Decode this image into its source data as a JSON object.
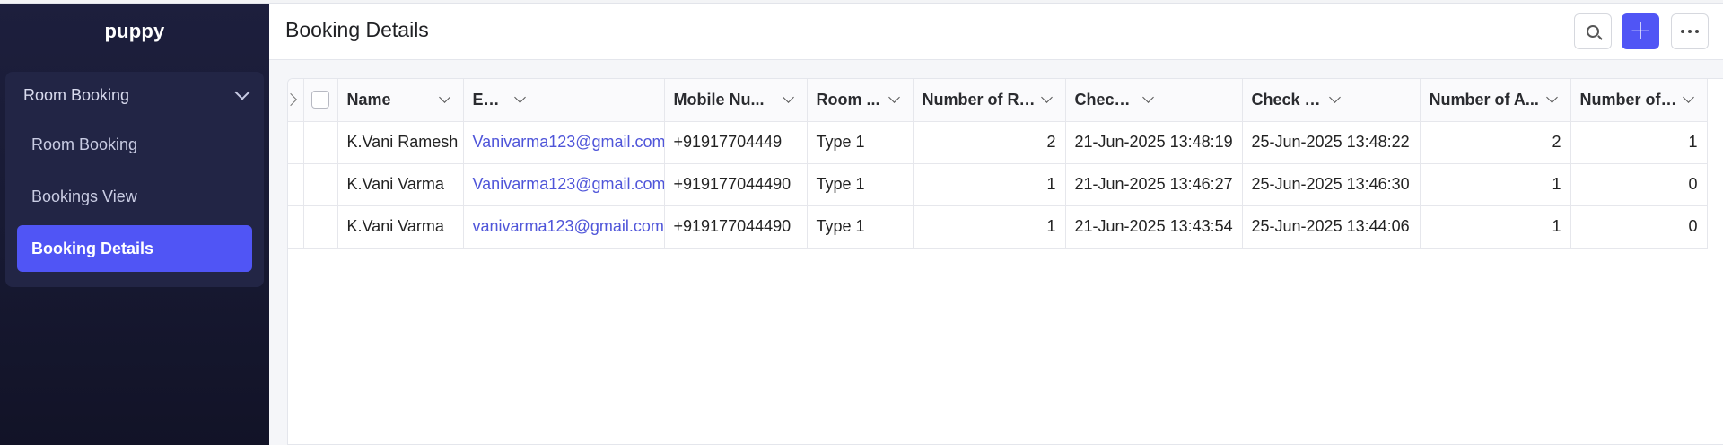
{
  "app": {
    "name": "puppy"
  },
  "sidebar": {
    "group_label": "Room Booking",
    "items": [
      {
        "label": "Room Booking",
        "active": false
      },
      {
        "label": "Bookings View",
        "active": false
      },
      {
        "label": "Booking Details",
        "active": true
      }
    ]
  },
  "header": {
    "title": "Booking Details",
    "buttons": {
      "search_icon": "search-icon",
      "add_icon": "plus-icon",
      "more_icon": "more-icon"
    }
  },
  "table": {
    "columns": [
      "Name",
      "Email",
      "Mobile Nu...",
      "Room ...",
      "Number of Ro...",
      "Check In",
      "Check Out",
      "Number of A...",
      "Number of ..."
    ],
    "rows": [
      [
        "K.Vani Ramesh",
        "Vanivarma123@gmail.com",
        "+91917704449",
        "Type 1",
        "2",
        "21-Jun-2025 13:48:19",
        "25-Jun-2025 13:48:22",
        "2",
        "1"
      ],
      [
        "K.Vani Varma",
        "Vanivarma123@gmail.com",
        "+919177044490",
        "Type 1",
        "1",
        "21-Jun-2025 13:46:27",
        "25-Jun-2025 13:46:30",
        "1",
        "0"
      ],
      [
        "K.Vani Varma",
        "vanivarma123@gmail.com",
        "+919177044490",
        "Type 1",
        "1",
        "21-Jun-2025 13:43:54",
        "25-Jun-2025 13:44:06",
        "1",
        "0"
      ]
    ]
  },
  "colors": {
    "accent": "#5055f5",
    "sidebar_bg": "#1d1f3d",
    "link": "#4f55d9"
  }
}
